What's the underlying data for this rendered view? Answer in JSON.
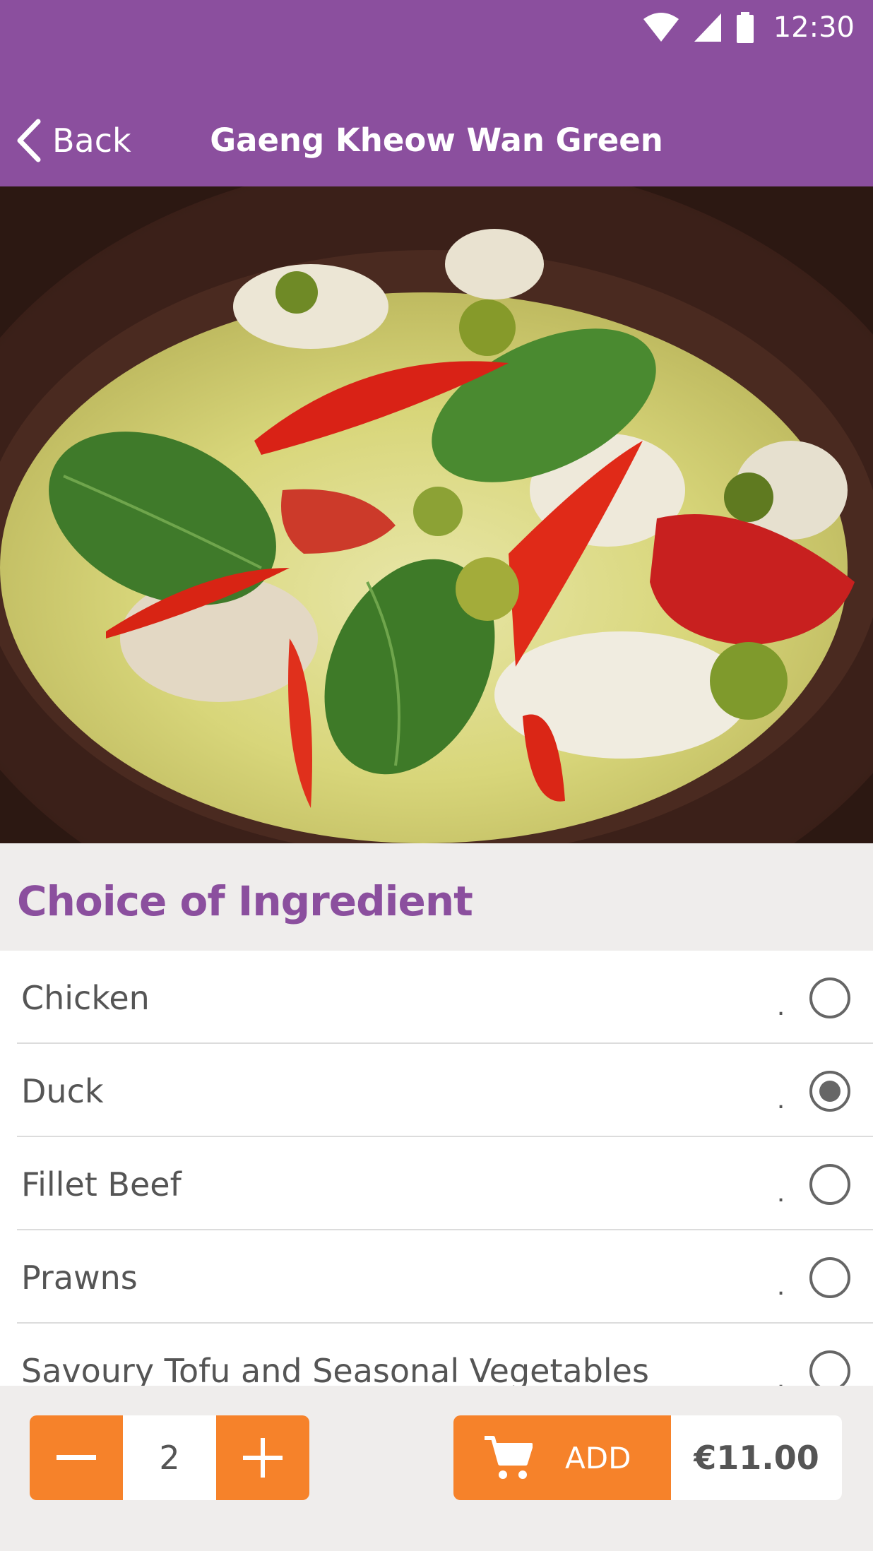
{
  "status_bar": {
    "time": "12:30"
  },
  "nav": {
    "back_label": "Back",
    "title": "Gaeng Kheow Wan Green"
  },
  "section": {
    "title": "Choice of Ingredient"
  },
  "options": [
    {
      "label": "Chicken",
      "marker": ".",
      "selected": false
    },
    {
      "label": "Duck",
      "marker": ".",
      "selected": true
    },
    {
      "label": "Fillet Beef",
      "marker": ".",
      "selected": false
    },
    {
      "label": "Prawns",
      "marker": ".",
      "selected": false
    },
    {
      "label": "Savoury Tofu and Seasonal Vegetables",
      "marker": ".",
      "selected": false
    }
  ],
  "order": {
    "quantity": "2",
    "add_label": "ADD",
    "price": "€11.00"
  },
  "colors": {
    "brand_purple": "#8b4f9e",
    "accent_orange": "#f6822a"
  }
}
